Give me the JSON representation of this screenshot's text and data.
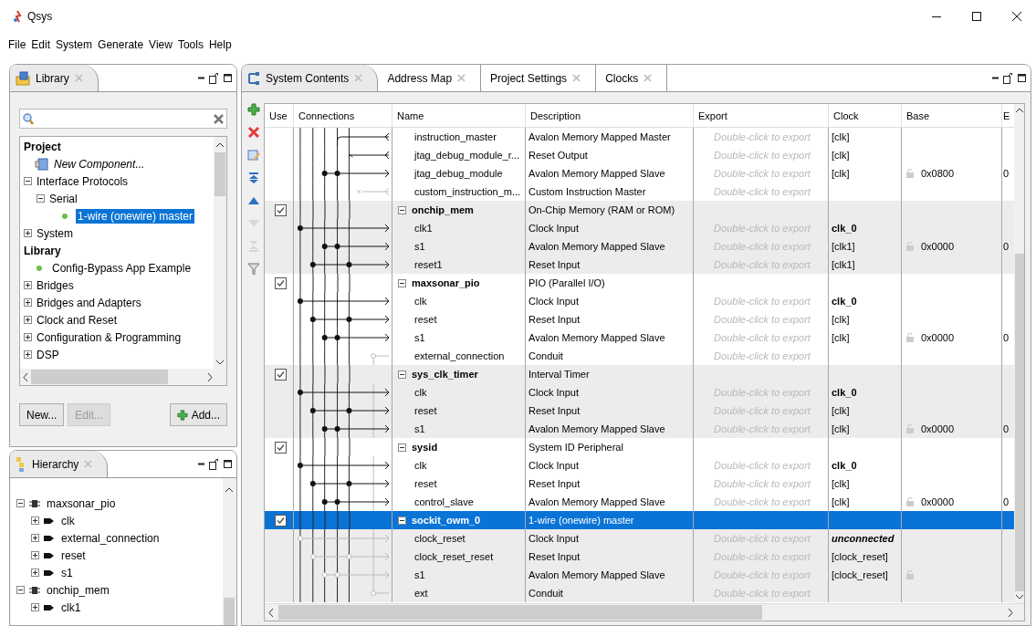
{
  "window": {
    "title": "Qsys"
  },
  "menu": [
    "File",
    "Edit",
    "System",
    "Generate",
    "View",
    "Tools",
    "Help"
  ],
  "library_panel": {
    "tab": "Library",
    "tree": [
      {
        "label": "Project",
        "kind": "category",
        "selected": false,
        "children": [
          {
            "label": "New Component...",
            "kind": "new",
            "selected": false
          },
          {
            "label": "Interface Protocols",
            "kind": "folder",
            "expanded": true,
            "selected": false,
            "children": [
              {
                "label": "Serial",
                "kind": "folder",
                "expanded": true,
                "selected": false,
                "children": [
                  {
                    "label": "1-wire (onewire) master",
                    "kind": "component",
                    "selected": true
                  }
                ]
              }
            ]
          },
          {
            "label": "System",
            "kind": "folder",
            "expanded": false,
            "selected": false
          }
        ]
      },
      {
        "label": "Library",
        "kind": "category",
        "selected": false,
        "children": [
          {
            "label": "Config-Bypass App Example",
            "kind": "component",
            "selected": false
          },
          {
            "label": "Bridges",
            "kind": "folder",
            "expanded": false,
            "selected": false
          },
          {
            "label": "Bridges and Adapters",
            "kind": "folder",
            "expanded": false,
            "selected": false
          },
          {
            "label": "Clock and Reset",
            "kind": "folder",
            "expanded": false,
            "selected": false
          },
          {
            "label": "Configuration & Programming",
            "kind": "folder",
            "expanded": false,
            "selected": false
          },
          {
            "label": "DSP",
            "kind": "folder",
            "expanded": false,
            "selected": false
          }
        ]
      }
    ],
    "buttons": [
      {
        "label": "New...",
        "disabled": false,
        "kind": "plain"
      },
      {
        "label": "Edit...",
        "disabled": true,
        "kind": "plain"
      },
      {
        "label": "Add...",
        "disabled": false,
        "kind": "add"
      }
    ]
  },
  "hierarchy_panel": {
    "tab": "Hierarchy",
    "tree": [
      {
        "label": "maxsonar_pio",
        "kind": "module",
        "expanded": true,
        "children": [
          {
            "label": "clk",
            "kind": "interface",
            "expanded": false
          },
          {
            "label": "external_connection",
            "kind": "interface",
            "expanded": false
          },
          {
            "label": "reset",
            "kind": "interface",
            "expanded": false
          },
          {
            "label": "s1",
            "kind": "interface",
            "expanded": false
          }
        ]
      },
      {
        "label": "onchip_mem",
        "kind": "module",
        "expanded": true,
        "children": [
          {
            "label": "clk1",
            "kind": "interface",
            "expanded": false
          }
        ]
      }
    ]
  },
  "editor": {
    "tabs": [
      {
        "label": "System Contents",
        "selected": true,
        "kind": "system"
      },
      {
        "label": "Address Map",
        "selected": false
      },
      {
        "label": "Project Settings",
        "selected": false
      },
      {
        "label": "Clocks",
        "selected": false
      }
    ],
    "toolbar": [
      {
        "kind": "add",
        "disabled": false
      },
      {
        "kind": "remove",
        "disabled": false
      },
      {
        "kind": "edit",
        "disabled": false
      },
      {
        "kind": "top",
        "disabled": false
      },
      {
        "kind": "up",
        "disabled": false
      },
      {
        "kind": "down",
        "disabled": true
      },
      {
        "kind": "bottom",
        "disabled": true
      },
      {
        "kind": "filter",
        "disabled": false
      }
    ],
    "table": {
      "columns": [
        "Use",
        "Connections",
        "Name",
        "Description",
        "Export",
        "Clock",
        "Base",
        "E"
      ],
      "groups": [
        {
          "interfaces": [
            {
              "name": "instruction_master",
              "kind": "master",
              "connected": true,
              "description": "Avalon Memory Mapped Master",
              "export": "Double-click to export",
              "clock": "[clk]",
              "clock_bold": false,
              "clock_italic": false
            },
            {
              "name": "jtag_debug_module_r...",
              "kind": "resetout",
              "connected": true,
              "description": "Reset Output",
              "export": "Double-click to export",
              "clock": "[clk]",
              "clock_bold": false,
              "clock_italic": false
            },
            {
              "name": "jtag_debug_module",
              "kind": "slave",
              "connected": true,
              "description": "Avalon Memory Mapped Slave",
              "export": "Double-click to export",
              "clock": "[clk]",
              "clock_bold": false,
              "clock_italic": false,
              "base_lock": true,
              "base": "0x0800",
              "column_8": "0"
            },
            {
              "name": "custom_instruction_m...",
              "kind": "custom",
              "connected": false,
              "description": "Custom Instruction Master",
              "export": "Double-click to export"
            }
          ]
        },
        {
          "name": "onchip_mem",
          "use": true,
          "expanded": true,
          "selected": false,
          "description": "On-Chip Memory (RAM or ROM)",
          "interfaces": [
            {
              "name": "clk1",
              "kind": "clock",
              "connected": true,
              "description": "Clock Input",
              "export": "Double-click to export",
              "clock": "clk_0",
              "clock_bold": true,
              "clock_italic": false
            },
            {
              "name": "s1",
              "kind": "slave",
              "connected": true,
              "description": "Avalon Memory Mapped Slave",
              "export": "Double-click to export",
              "clock": "[clk1]",
              "clock_bold": false,
              "clock_italic": false,
              "base_lock": true,
              "base": "0x0000",
              "column_8": "0"
            },
            {
              "name": "reset1",
              "kind": "reset",
              "connected": true,
              "description": "Reset Input",
              "export": "Double-click to export",
              "clock": "[clk1]",
              "clock_bold": false,
              "clock_italic": false
            }
          ]
        },
        {
          "name": "maxsonar_pio",
          "use": true,
          "expanded": true,
          "selected": false,
          "description": "PIO (Parallel I/O)",
          "interfaces": [
            {
              "name": "clk",
              "kind": "clock",
              "connected": true,
              "description": "Clock Input",
              "export": "Double-click to export",
              "clock": "clk_0",
              "clock_bold": true,
              "clock_italic": false
            },
            {
              "name": "reset",
              "kind": "reset",
              "connected": true,
              "description": "Reset Input",
              "export": "Double-click to export",
              "clock": "[clk]",
              "clock_bold": false,
              "clock_italic": false
            },
            {
              "name": "s1",
              "kind": "slave",
              "connected": true,
              "description": "Avalon Memory Mapped Slave",
              "export": "Double-click to export",
              "clock": "[clk]",
              "clock_bold": false,
              "clock_italic": false,
              "base_lock": true,
              "base": "0x0000",
              "column_8": "0"
            },
            {
              "name": "external_connection",
              "kind": "conduit",
              "connected": false,
              "description": "Conduit",
              "export": "Double-click to export"
            }
          ]
        },
        {
          "name": "sys_clk_timer",
          "use": true,
          "expanded": true,
          "selected": false,
          "description": "Interval Timer",
          "interfaces": [
            {
              "name": "clk",
              "kind": "clock",
              "connected": true,
              "description": "Clock Input",
              "export": "Double-click to export",
              "clock": "clk_0",
              "clock_bold": true,
              "clock_italic": false
            },
            {
              "name": "reset",
              "kind": "reset",
              "connected": true,
              "description": "Reset Input",
              "export": "Double-click to export",
              "clock": "[clk]",
              "clock_bold": false,
              "clock_italic": false
            },
            {
              "name": "s1",
              "kind": "slave",
              "connected": true,
              "description": "Avalon Memory Mapped Slave",
              "export": "Double-click to export",
              "clock": "[clk]",
              "clock_bold": false,
              "clock_italic": false,
              "base_lock": true,
              "base": "0x0000",
              "column_8": "0"
            }
          ]
        },
        {
          "name": "sysid",
          "use": true,
          "expanded": true,
          "selected": false,
          "description": "System ID Peripheral",
          "interfaces": [
            {
              "name": "clk",
              "kind": "clock",
              "connected": true,
              "description": "Clock Input",
              "export": "Double-click to export",
              "clock": "clk_0",
              "clock_bold": true,
              "clock_italic": false
            },
            {
              "name": "reset",
              "kind": "reset",
              "connected": true,
              "description": "Reset Input",
              "export": "Double-click to export",
              "clock": "[clk]",
              "clock_bold": false,
              "clock_italic": false
            },
            {
              "name": "control_slave",
              "kind": "slave",
              "connected": true,
              "description": "Avalon Memory Mapped Slave",
              "export": "Double-click to export",
              "clock": "[clk]",
              "clock_bold": false,
              "clock_italic": false,
              "base_lock": true,
              "base": "0x0000",
              "column_8": "0"
            }
          ]
        },
        {
          "name": "sockit_owm_0",
          "use": true,
          "expanded": true,
          "selected": true,
          "description": "1-wire (onewire) master",
          "interfaces": [
            {
              "name": "clock_reset",
              "kind": "clock",
              "connected": false,
              "description": "Clock Input",
              "export": "Double-click to export",
              "clock": "unconnected",
              "clock_bold": true,
              "clock_italic": true
            },
            {
              "name": "clock_reset_reset",
              "kind": "reset",
              "connected": false,
              "description": "Reset Input",
              "export": "Double-click to export",
              "clock": "[clock_reset]",
              "clock_bold": false,
              "clock_italic": false
            },
            {
              "name": "s1",
              "kind": "slave",
              "connected": false,
              "description": "Avalon Memory Mapped Slave",
              "export": "Double-click to export",
              "clock": "[clock_reset]",
              "clock_bold": false,
              "clock_italic": false,
              "base_lock": true
            },
            {
              "name": "ext",
              "kind": "conduit",
              "connected": false,
              "description": "Conduit",
              "export": "Double-click to export"
            }
          ]
        }
      ]
    }
  }
}
